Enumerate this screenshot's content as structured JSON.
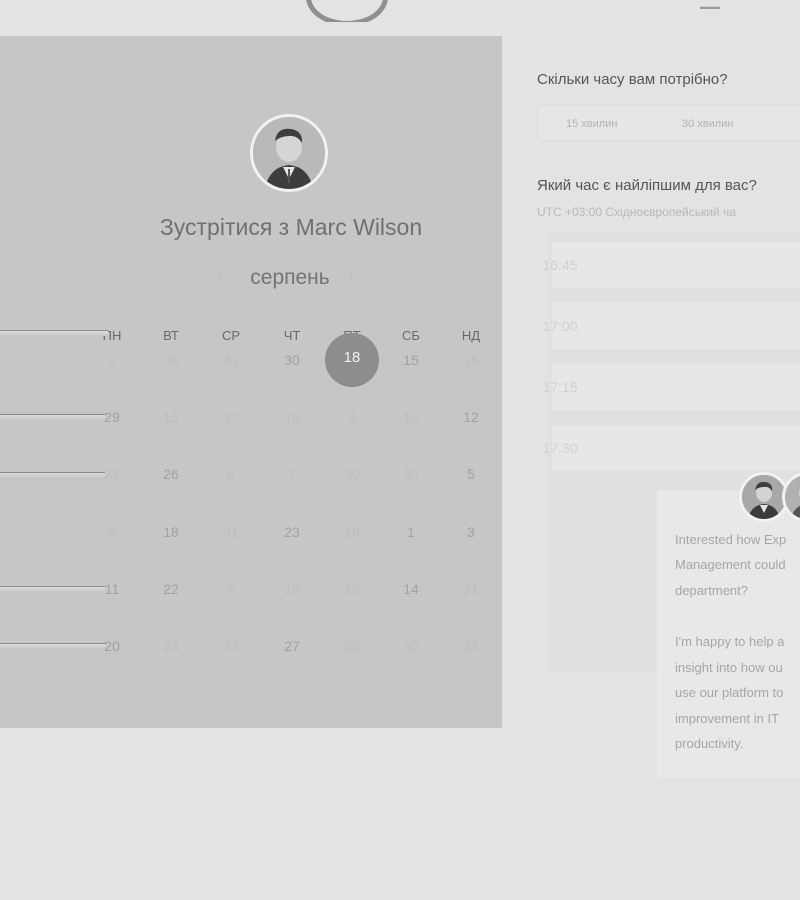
{
  "meeting": {
    "title": "Зустрітися з Marc Wilson",
    "month": "серпень",
    "prev_icon": "chevron-left-icon",
    "next_icon": "chevron-right-icon"
  },
  "calendar": {
    "weekdays": [
      "ПН",
      "ВТ",
      "СР",
      "ЧТ",
      "ПТ",
      "СБ",
      "НД"
    ],
    "rows": [
      [
        "9",
        "30",
        "31",
        "30",
        "18",
        "15",
        "16"
      ],
      [
        "29",
        "16",
        "17",
        "18",
        "9",
        "10",
        "12"
      ],
      [
        "31",
        "26",
        "6",
        "7",
        "30",
        "30",
        "5"
      ],
      [
        "6",
        "18",
        "31",
        "23",
        "16",
        "1",
        "3"
      ],
      [
        "11",
        "22",
        "5",
        "19",
        "13",
        "14",
        "21"
      ],
      [
        "20",
        "24",
        "13",
        "27",
        "28",
        "30",
        "31"
      ]
    ],
    "selected": "18"
  },
  "duration": {
    "question": "Скільки часу вам потрібно?",
    "options": [
      "15 хвилин",
      "30 хвилин"
    ]
  },
  "time": {
    "question": "Який час є найліпшим для вас?",
    "timezone": "UTC +03:00 Східноєвропейський ча",
    "slots": [
      "16:45",
      "17:00",
      "17:15",
      "17:30"
    ]
  },
  "info": {
    "lines": [
      "Interested how Exp",
      "Management could",
      "department?",
      "",
      "I'm happy to help a",
      "insight into how ou",
      "use our platform to",
      "improvement in IT",
      "productivity."
    ]
  },
  "colors": {
    "panel_bg": "#c6c6c6",
    "selected_day": "#8d8d8d",
    "page_bg": "#e3e3e3"
  }
}
